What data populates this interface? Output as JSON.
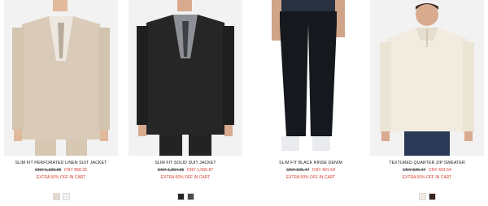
{
  "products": [
    {
      "name": "SLIM FIT PERFORATED LINEN SUIT JACKET",
      "original_price": "CNY 1,320.65",
      "sale_price": "CNY 858.32",
      "promo": "EXTRA 50% OFF IN CART",
      "swatches": [
        "#e3d8c9",
        "#efefef"
      ]
    },
    {
      "name": "SLIM FIT SOLID SUIT JACKET",
      "original_price": "CNY 1,394.65",
      "sale_price": "CNY 1,056.87",
      "promo": "EXTRA 50% OFF IN CART",
      "swatches": [
        "#252525",
        "#4c4c4c"
      ]
    },
    {
      "name": "SLIM FIT BLACK RINSE DENIM",
      "original_price": "CNY 625.47",
      "sale_price": "CNY 401.54",
      "promo": "EXTRA 50% OFF IN CART",
      "swatches": []
    },
    {
      "name": "TEXTURED QUARTER ZIP SWEATER",
      "original_price": "CNY 526.47",
      "sale_price": "CNY 401.54",
      "promo": "EXTRA 50% OFF IN CART",
      "swatches": [
        "#f1ecdf",
        "#3a2420"
      ]
    }
  ]
}
